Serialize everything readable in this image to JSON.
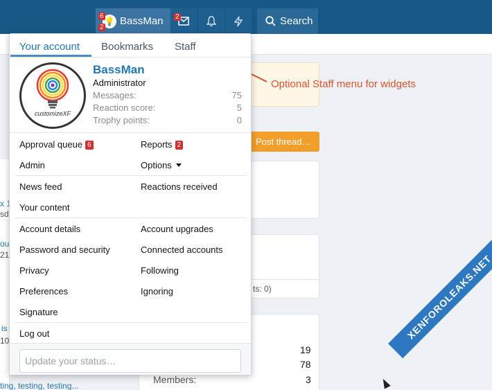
{
  "navbar": {
    "user_avatar_glyph": "💡",
    "user_name": "BassMan",
    "user_badge_alerts": "6",
    "user_badge_msgs": "2",
    "inbox_badge": "2",
    "search_label": "Search"
  },
  "menu": {
    "tabs": [
      {
        "label": "Your account"
      },
      {
        "label": "Bookmarks"
      },
      {
        "label": "Staff"
      }
    ],
    "profile": {
      "name": "BassMan",
      "role": "Administrator",
      "avatar_caption": "customizeXF",
      "stats": [
        {
          "label": "Messages:",
          "value": "75"
        },
        {
          "label": "Reaction score:",
          "value": "5"
        },
        {
          "label": "Trophy points:",
          "value": "0"
        }
      ]
    },
    "staff_links": {
      "approval_queue": "Approval queue",
      "approval_count": "6",
      "reports": "Reports",
      "reports_count": "2",
      "admin": "Admin",
      "options": "Options"
    },
    "feed_links": {
      "news_feed": "News feed",
      "reactions_received": "Reactions received",
      "your_content": "Your content"
    },
    "account_links": {
      "account_details": "Account details",
      "account_upgrades": "Account upgrades",
      "password_security": "Password and security",
      "connected_accounts": "Connected accounts",
      "privacy": "Privacy",
      "following": "Following",
      "preferences": "Preferences",
      "ignoring": "Ignoring",
      "signature": "Signature"
    },
    "logout": "Log out",
    "status_placeholder": "Update your status…"
  },
  "annotation": "Optional Staff menu for widgets",
  "background": {
    "post_thread": "Post thread…",
    "frag_ts": "ts: 0)",
    "frag_members": "Members:",
    "stat_1": "19",
    "stat_2": "78",
    "stat_3": "3",
    "frag_testing": "ting, testing, testing...",
    "frag_x": "x 1",
    "frag_sd": "sda",
    "frag_ou": "ou",
    "frag_21": "21",
    "frag_is": "is",
    "frag_10": "10"
  },
  "watermark": "XENFOROLEAKS.NET",
  "colors": {
    "navbar": "#185886",
    "link": "#2577b1",
    "badge": "#d32f2f",
    "annotation": "#d9532c",
    "post_button": "#f29e2b"
  }
}
